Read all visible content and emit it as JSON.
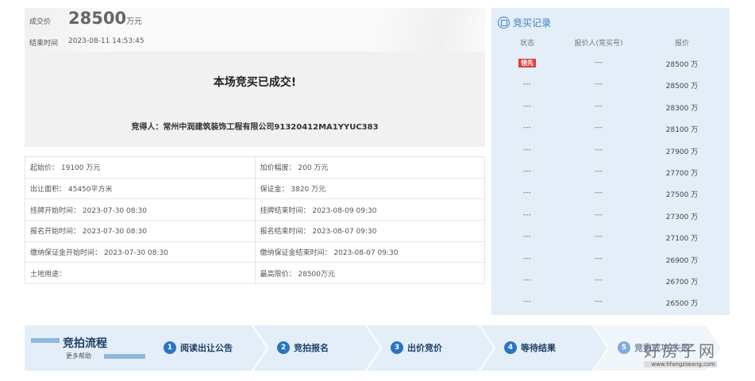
{
  "summary": {
    "deal_label": "成交价",
    "deal_price": "28500",
    "deal_unit": "万元",
    "end_label": "结束时间",
    "end_time": "2023-08-11 14:53:45"
  },
  "result": {
    "title": "本场竞买已成交!",
    "winner": "竞得人：常州中润建筑装饰工程有限公司91320412MA1YYUC383"
  },
  "info": [
    [
      "起始价： 19100 万元",
      "加价幅度： 200 万元"
    ],
    [
      "出让面积： 45450平方米",
      "保证金： 3820 万元"
    ],
    [
      "挂牌开始时间： 2023-07-30 08:30",
      "挂牌结束时间： 2023-08-09 09:30"
    ],
    [
      "报名开始时间： 2023-07-30 08:30",
      "报名结束时间： 2023-08-07 09:30"
    ],
    [
      "缴纳保证金开始时间： 2023-07-30 08:30",
      "缴纳保证金结束时间： 2023-08-07 09:30"
    ],
    [
      "土地用途：",
      "最高限价： 28500万元"
    ]
  ],
  "records": {
    "title": "竞买记录",
    "headers": [
      "状态",
      "报价人(竞买号)",
      "报价"
    ],
    "rows": [
      [
        "领先",
        "---",
        "28500 万"
      ],
      [
        "---",
        "---",
        "28500 万"
      ],
      [
        "---",
        "---",
        "28300 万"
      ],
      [
        "---",
        "---",
        "28100 万"
      ],
      [
        "---",
        "---",
        "27900 万"
      ],
      [
        "---",
        "---",
        "27700 万"
      ],
      [
        "---",
        "---",
        "27500 万"
      ],
      [
        "---",
        "---",
        "27300 万"
      ],
      [
        "---",
        "---",
        "27100 万"
      ],
      [
        "---",
        "---",
        "26900 万"
      ],
      [
        "---",
        "---",
        "26700 万"
      ],
      [
        "---",
        "---",
        "26500 万"
      ]
    ]
  },
  "flow": {
    "title": "竞拍流程",
    "help": "更多帮助",
    "steps": [
      {
        "n": "1",
        "label": "阅读出让公告"
      },
      {
        "n": "2",
        "label": "竞拍报名"
      },
      {
        "n": "3",
        "label": "出价竞价"
      },
      {
        "n": "4",
        "label": "等待结果"
      },
      {
        "n": "5",
        "label": "竞拍成功/失败"
      }
    ]
  },
  "watermark": {
    "text": "好房子网",
    "url": "www.hfangziwang.com"
  },
  "colors": {
    "accent": "#3a7fc4",
    "lead": "#d9403a",
    "panel": "#e4eef8"
  }
}
